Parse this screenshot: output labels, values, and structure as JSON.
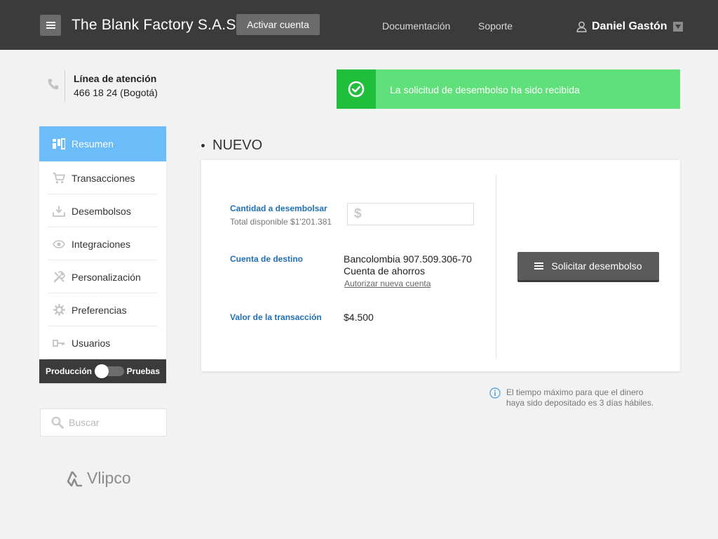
{
  "header": {
    "company": "The Blank Factory S.A.S",
    "activate_label": "Activar cuenta",
    "nav": [
      {
        "label": "Documentación"
      },
      {
        "label": "Soporte"
      }
    ],
    "user_name": "Daniel Gastón"
  },
  "contact": {
    "title": "Línea de atención",
    "number": "466 18 24 (Bogotá)"
  },
  "notification": {
    "message": "La solicitud de desembolso ha sido recibida",
    "color": "#5fe07a",
    "icon": "check-circle-icon"
  },
  "sidebar": {
    "items": [
      {
        "label": "Resumen",
        "icon": "dashboard-icon",
        "active": true
      },
      {
        "label": "Transacciones",
        "icon": "cart-icon"
      },
      {
        "label": "Desembolsos",
        "icon": "download-icon"
      },
      {
        "label": "Integraciones",
        "icon": "eye-icon"
      },
      {
        "label": "Personalización",
        "icon": "tools-icon"
      },
      {
        "label": "Preferencias",
        "icon": "gear-icon"
      },
      {
        "label": "Usuarios",
        "icon": "key-icon"
      }
    ],
    "env_left": "Producción",
    "env_right": "Pruebas",
    "active_color": "#6bbcf8"
  },
  "search": {
    "placeholder": "Buscar"
  },
  "logo": {
    "text": "Vlipco"
  },
  "section": {
    "title": "NUEVO"
  },
  "form": {
    "amount_label": "Cantidad a desembolsar",
    "available": "Total disponible $1'201.381",
    "currency_symbol": "$",
    "amount_value": "",
    "destination_label": "Cuenta de destino",
    "bank_account": "Bancolombia 907.509.306-70",
    "account_type": "Cuenta de ahorros",
    "authorize_link": "Autorizar nueva cuenta",
    "fee_label": "Valor de la transacción",
    "fee_value": "$4.500",
    "submit_label": "Solicitar desembolso"
  },
  "note": {
    "line1": "El tiempo máximo para que el dinero",
    "line2": "haya sido depositado es 3 días hábiles."
  }
}
